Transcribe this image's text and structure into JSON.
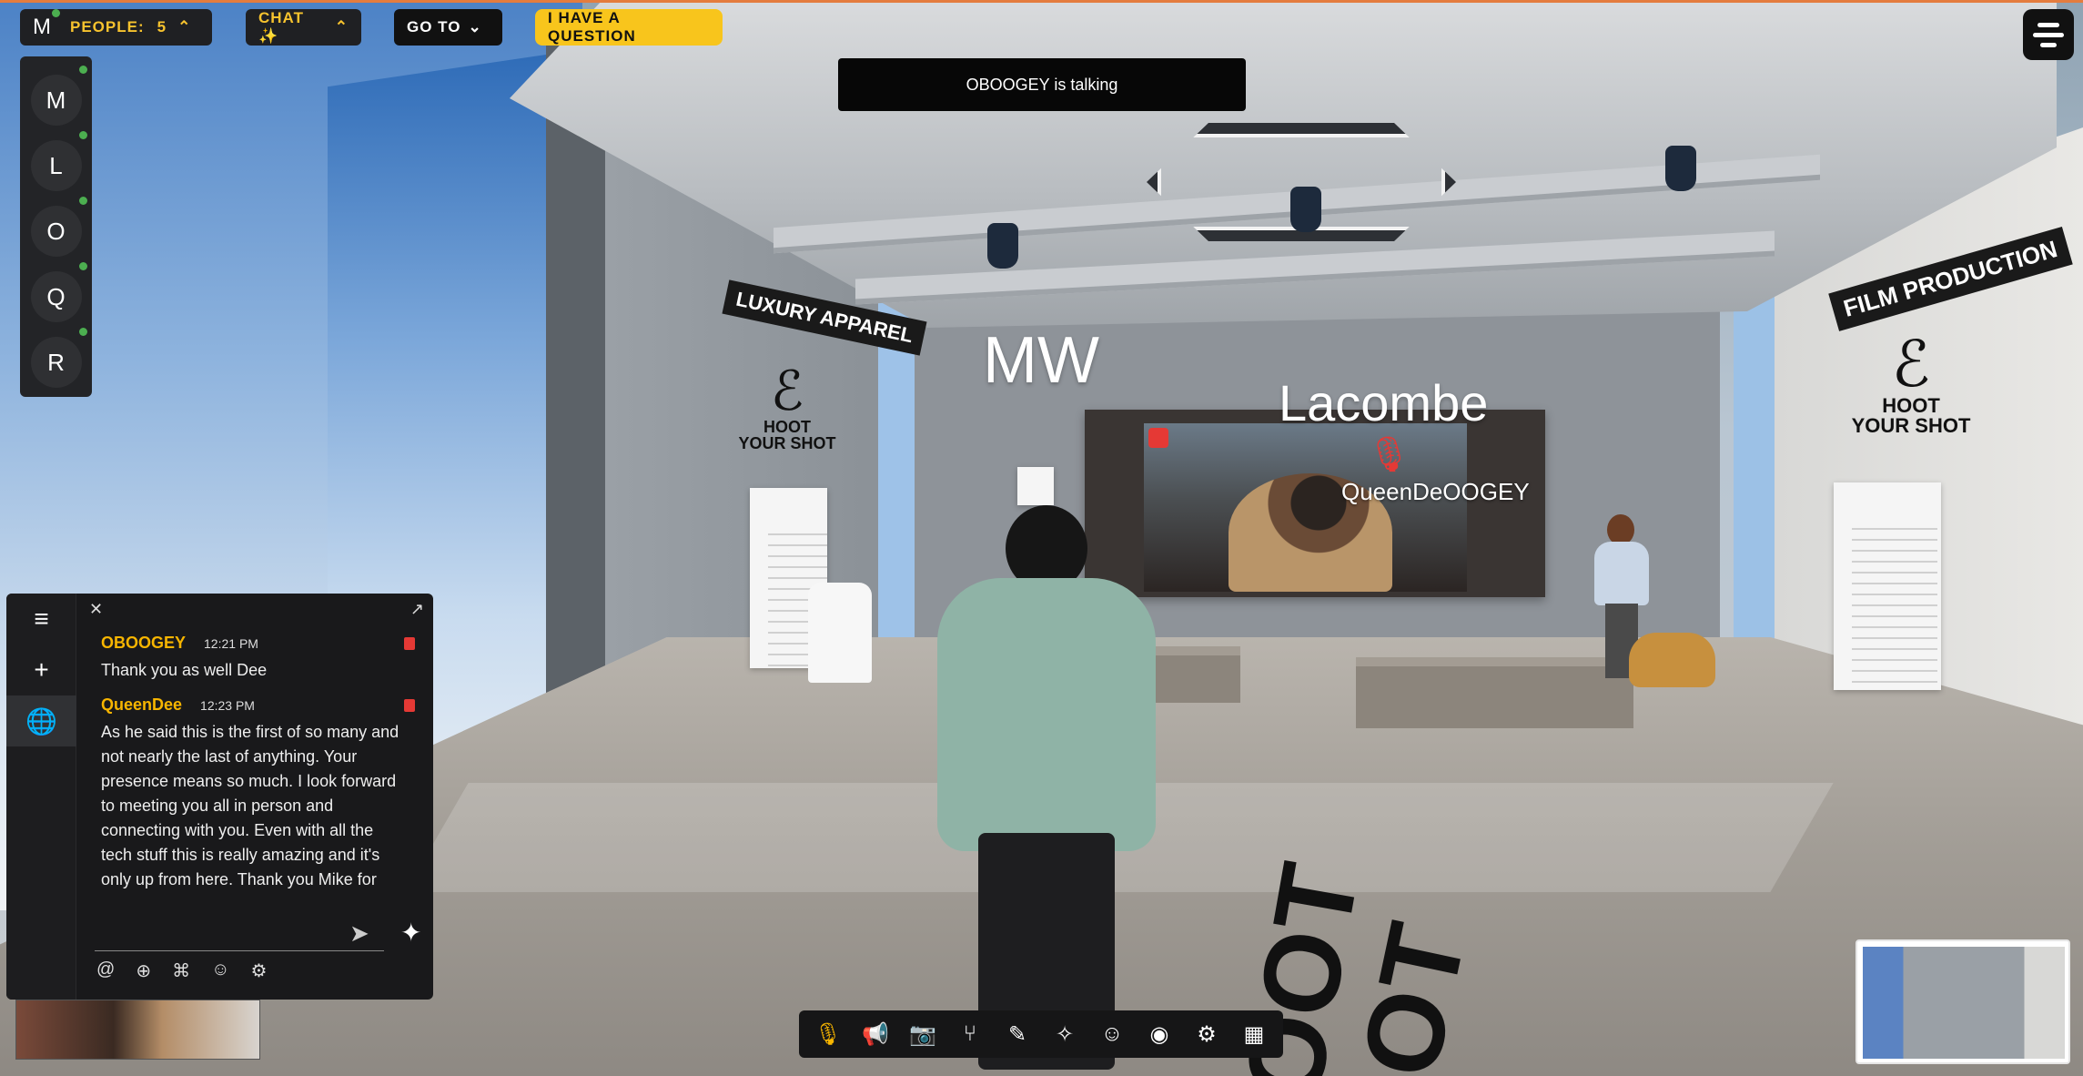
{
  "topbar": {
    "logo": "M",
    "people_label": "PEOPLE:",
    "people_count": "5",
    "chat_label": "CHAT ✨",
    "goto_label": "GO TO",
    "question_label": "I HAVE A QUESTION"
  },
  "talking_banner": "OBOOGEY is talking",
  "people": [
    "M",
    "L",
    "O",
    "Q",
    "R"
  ],
  "scene": {
    "sign_left_plaque": "LUXURY APPAREL",
    "sign_left_line1": "HOOT",
    "sign_left_line2": "YOUR SHOT",
    "sign_right_plaque": "FILM PRODUCTION",
    "sign_right_line1": "HOOT",
    "sign_right_line2": "YOUR SHOT",
    "label_mw": "MW",
    "label_lacombe": "Lacombe",
    "name_tag": "QueenDeOOGEY",
    "floor_text_1": "OOT",
    "floor_text_2": "OT"
  },
  "chat": {
    "messages": [
      {
        "name": "OBOOGEY",
        "time": "12:21 PM",
        "text": "Thank you as well Dee"
      },
      {
        "name": "QueenDee",
        "time": "12:23 PM",
        "text": "As he said this is the first of so many and\nnot nearly the last of anything. Your\npresence means so much. I look forward\nto meeting you all in person and\nconnecting with you. Even with all the\ntech stuff this is really amazing and it's\nonly up from here. Thank you Mike for"
      }
    ],
    "input_placeholder": ""
  },
  "toolbar_icons": [
    "mic-icon",
    "megaphone-icon",
    "camera-icon",
    "seat-icon",
    "pencil-icon",
    "sparkle-icon",
    "emoji-icon",
    "record-icon",
    "gear-icon",
    "grid-icon"
  ],
  "colors": {
    "accent": "#f8c51c",
    "panel": "#1f2023",
    "online": "#4caf50",
    "delete": "#e53935"
  }
}
